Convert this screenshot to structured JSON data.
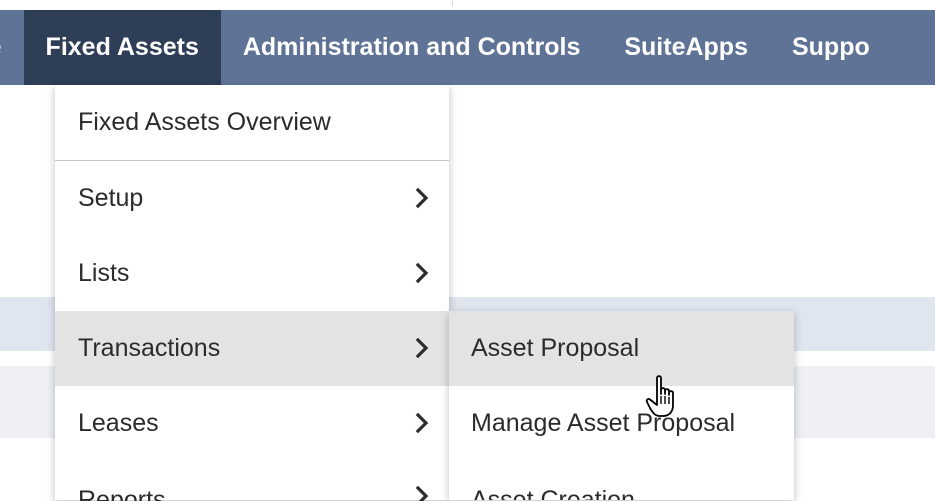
{
  "nav": {
    "items": [
      {
        "label": "rce"
      },
      {
        "label": "Fixed Assets"
      },
      {
        "label": "Administration and Controls"
      },
      {
        "label": "SuiteApps"
      },
      {
        "label": "Suppo"
      }
    ],
    "active_index": 1
  },
  "dropdown": {
    "items": [
      {
        "label": "Fixed Assets Overview"
      },
      {
        "label": "Setup"
      },
      {
        "label": "Lists"
      },
      {
        "label": "Transactions"
      },
      {
        "label": "Leases"
      },
      {
        "label": "Reports"
      }
    ],
    "highlighted_index": 3
  },
  "submenu": {
    "items": [
      {
        "label": "Asset Proposal"
      },
      {
        "label": "Manage Asset Proposal"
      },
      {
        "label": "Asset Creation"
      }
    ],
    "hovered_index": 0
  },
  "colors": {
    "nav_bg": "#5f7396",
    "nav_active_bg": "#2f3e57",
    "highlight_bg": "#e3e3e3",
    "band_blue": "#dfe6f0"
  },
  "icons": {
    "chevron": "chevron-right-icon",
    "cursor": "hand-pointer-icon"
  }
}
